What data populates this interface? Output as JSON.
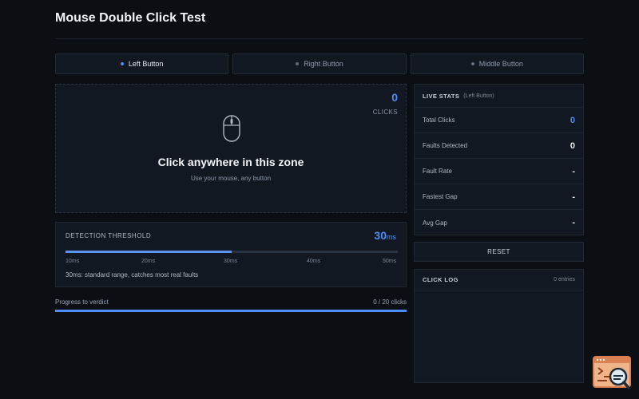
{
  "page": {
    "title": "Mouse Double Click Test"
  },
  "tabs": [
    {
      "label": "Left Button",
      "active": true
    },
    {
      "label": "Right Button",
      "active": false
    },
    {
      "label": "Middle Button",
      "active": false
    }
  ],
  "click_zone": {
    "count": "0",
    "count_label": "CLICKS",
    "icon": "mouse-icon",
    "title": "Click anywhere in this zone",
    "subtitle": "Use your mouse, any button"
  },
  "threshold": {
    "label": "DETECTION THRESHOLD",
    "value": "30",
    "unit": "ms",
    "level_fraction": 0.5,
    "ticks": [
      "10ms",
      "20ms",
      "30ms",
      "40ms",
      "50ms"
    ],
    "description": "30ms: standard range, catches most real faults"
  },
  "progress": {
    "label": "Progress to verdict",
    "count": "0 / 20 clicks",
    "fraction": 1.0
  },
  "stats": {
    "heading": "LIVE STATS",
    "subheading": "(Left Button)",
    "rows": [
      {
        "label": "Total Clicks",
        "value": "0"
      },
      {
        "label": "Faults Detected",
        "value": "0"
      },
      {
        "label": "Fault Rate",
        "value": "-"
      },
      {
        "label": "Fastest Gap",
        "value": "-"
      },
      {
        "label": "Avg Gap",
        "value": "-"
      }
    ]
  },
  "reset_label": "RESET",
  "log": {
    "heading": "CLICK LOG",
    "entries": "0 entries"
  },
  "colors": {
    "accent": "#4e8df5",
    "background": "#0b0e13",
    "panel": "#121821"
  },
  "corner_icon": "terminal-search-icon"
}
